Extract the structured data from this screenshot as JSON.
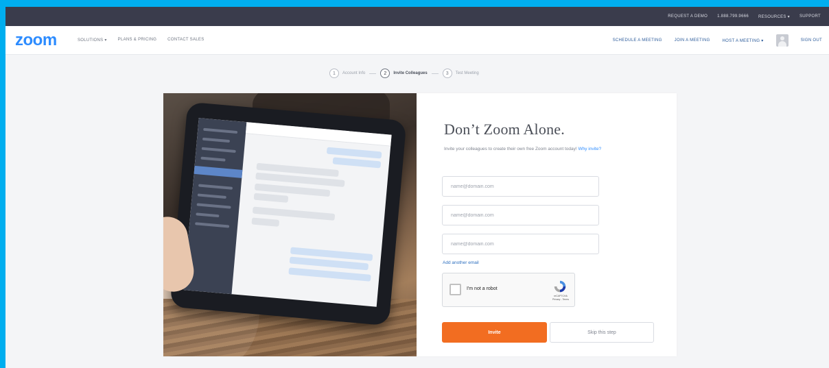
{
  "utility_bar": {
    "items": [
      "REQUEST A DEMO",
      "1.888.799.9666",
      "RESOURCES ▾",
      "SUPPORT"
    ]
  },
  "nav": {
    "logo": "zoom",
    "left_items": [
      "SOLUTIONS ▾",
      "PLANS & PRICING",
      "CONTACT SALES"
    ],
    "right_items": [
      "SCHEDULE A MEETING",
      "JOIN A MEETING",
      "HOST A MEETING ▾"
    ],
    "sign_out": "SIGN OUT"
  },
  "stepper": {
    "steps": [
      {
        "num": "1",
        "label": "Account Info"
      },
      {
        "num": "2",
        "label": "Invite Colleagues"
      },
      {
        "num": "3",
        "label": "Test Meeting"
      }
    ],
    "active_index": 1
  },
  "form": {
    "title": "Don’t Zoom Alone.",
    "subtitle": "Invite your colleagues to create their own free Zoom account today!",
    "subtitle_link": "Why invite?",
    "email_placeholder": "name@domain.com",
    "add_link": "Add another email",
    "captcha_label": "I'm not a robot",
    "captcha_brand": "reCAPTCHA",
    "captcha_terms": "Privacy - Terms",
    "invite_button": "Invite",
    "skip_button": "Skip this step"
  },
  "colors": {
    "accent": "#2d8cff",
    "cta": "#f26d21",
    "utility_bar": "#3a3c4c",
    "outer_border": "#00aeef"
  }
}
